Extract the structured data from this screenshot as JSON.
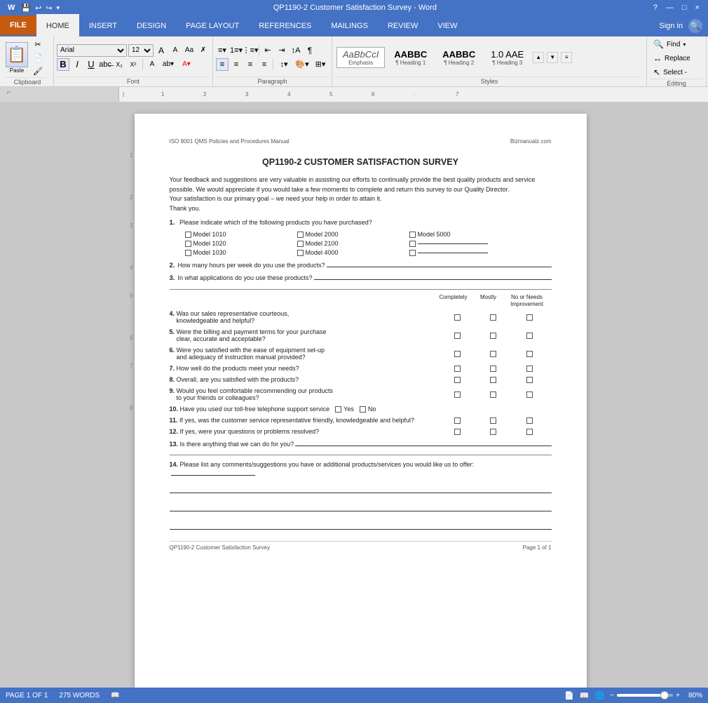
{
  "window": {
    "title": "QP1190-2 Customer Satisfaction Survey - Word",
    "controls": [
      "?",
      "—",
      "□",
      "×"
    ]
  },
  "ribbon": {
    "tabs": [
      "FILE",
      "HOME",
      "INSERT",
      "DESIGN",
      "PAGE LAYOUT",
      "REFERENCES",
      "MAILINGS",
      "REVIEW",
      "VIEW"
    ],
    "active_tab": "HOME",
    "file_tab": "FILE",
    "sign_in": "Sign in",
    "groups": {
      "clipboard": "Clipboard",
      "font": "Font",
      "paragraph": "Paragraph",
      "styles": "Styles",
      "editing": "Editing"
    },
    "font": {
      "name": "Arial",
      "size": "12"
    },
    "styles": [
      {
        "label": "AaBbCcI",
        "name": "Emphasis",
        "italic": true
      },
      {
        "label": "AABBC",
        "name": "¶ Heading 1",
        "bold": true
      },
      {
        "label": "AABBC",
        "name": "¶ Heading 2",
        "bold": true
      },
      {
        "label": "1.0 AAE",
        "name": "¶ Heading 3"
      }
    ],
    "editing": {
      "find": "Find",
      "replace": "Replace",
      "select": "Select -"
    }
  },
  "document": {
    "header_left": "ISO 9001 QMS Policies and Procedures Manual",
    "header_right": "Bizmanualz.com",
    "title": "QP1190-2 CUSTOMER SATISFACTION SURVEY",
    "intro": "Your feedback and suggestions are very valuable in assisting our efforts to continually provide the best quality products and service possible.  We would appreciate if you would take a few moments to complete and return this survey to our Quality Director.\nYour satisfaction is our primary goal – we need your help in order to attain it.\nThank you.",
    "questions": [
      {
        "num": "1.",
        "text": "Please indicate which of the following products you have purchased?"
      },
      {
        "num": "2.",
        "text": "How many hours per week do you use the products?"
      },
      {
        "num": "3.",
        "text": "In what applications do you use these products?"
      }
    ],
    "products": [
      "Model 1010",
      "Model 2000",
      "Model 5000",
      "Model 1020",
      "Model 2100",
      "_______________",
      "Model 1030",
      "Model 4000",
      "_______________"
    ],
    "rating_header": {
      "col1": "Completely",
      "col2": "Mostly",
      "col3": "No or Needs\nImprovement"
    },
    "rating_questions": [
      {
        "num": "4.",
        "text": "Was our sales representative courteous, knowledgeable and helpful?"
      },
      {
        "num": "5.",
        "text": "Were the billing and payment terms for your purchase clear, accurate and acceptable?"
      },
      {
        "num": "6.",
        "text": "Were you satisfied with the ease of equipment set-up and adequacy of instruction manual provided?"
      },
      {
        "num": "7.",
        "text": "How well do the products meet your needs?"
      },
      {
        "num": "8.",
        "text": "Overall, are you satisfied with the products?"
      },
      {
        "num": "9.",
        "text": "Would you feel comfortable recommending our products to your friends or colleagues?"
      }
    ],
    "q10": {
      "num": "10.",
      "text": "Have you used our toll-free telephone support service"
    },
    "q11": {
      "num": "11.",
      "text": "If yes, was the customer service representative friendly, knowledgeable and helpful?"
    },
    "q12": {
      "num": "12.",
      "text": "If yes, were your questions or problems resolved?"
    },
    "q13": {
      "num": "13.",
      "text": "Is there anything that we can do for you?"
    },
    "q14": {
      "num": "14.",
      "text": "Please list any comments/suggestions you have or additional products/services you would like us to offer:"
    },
    "footer_left": "QP1190-2 Customer Satisfaction Survey",
    "footer_right": "Page 1 of 1"
  },
  "status_bar": {
    "page": "PAGE 1 OF 1",
    "words": "275 WORDS",
    "zoom": "80%"
  }
}
